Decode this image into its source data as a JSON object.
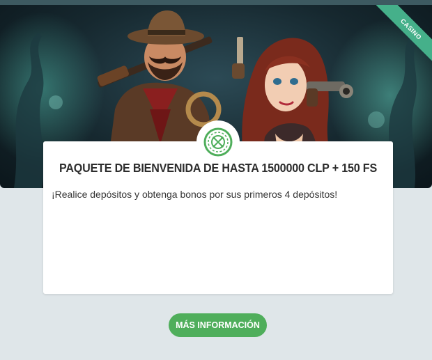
{
  "hero": {
    "ribbon_label": "CASINO",
    "image_alt": "Cowboy and cowgirl characters with revolvers and rifle in a dark green forest"
  },
  "promo": {
    "title": "PAQUETE DE BIENVENIDA DE HASTA 1500000 CLP + 150 FS",
    "description": "¡Realice depósitos y obtenga bonos por sus primeros 4 depósitos!",
    "badge_icon": "roulette-icon"
  },
  "cta": {
    "label": "MÁS INFORMACIÓN"
  },
  "colors": {
    "accent_green": "#4fae5b",
    "ribbon_teal": "#45b08a",
    "background": "#dfe6e9",
    "title_text": "#2d2d2d"
  }
}
